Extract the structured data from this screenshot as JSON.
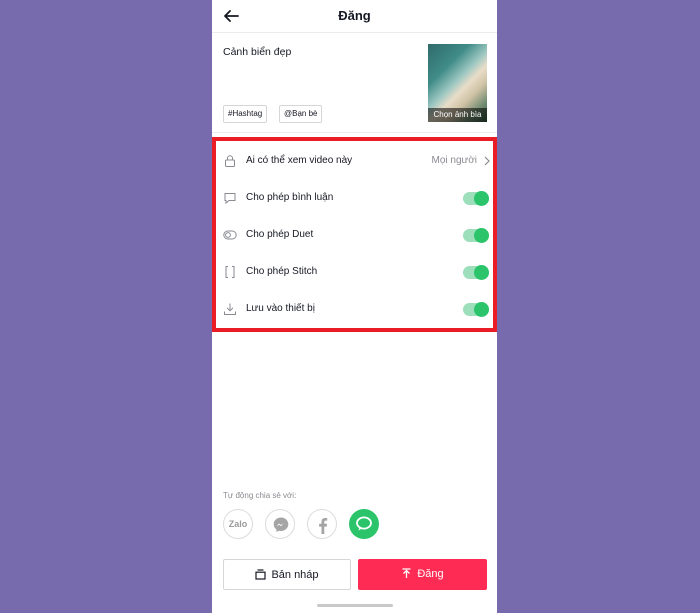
{
  "header": {
    "title": "Đăng"
  },
  "post": {
    "caption": "Cảnh biển đẹp",
    "cover_label": "Chọn ảnh bìa",
    "chips": [
      "#Hashtag",
      "@Bạn bè"
    ]
  },
  "settings": {
    "privacy": {
      "label": "Ai có thể xem video này",
      "value": "Mọi người"
    },
    "toggles": [
      {
        "label": "Cho phép bình luận",
        "on": true
      },
      {
        "label": "Cho phép Duet",
        "on": true
      },
      {
        "label": "Cho phép Stitch",
        "on": true
      },
      {
        "label": "Lưu vào thiết bị",
        "on": true
      }
    ]
  },
  "share": {
    "title": "Tự động chia sẻ với:",
    "zalo_label": "Zalo",
    "targets": [
      "zalo",
      "messenger",
      "facebook",
      "sms"
    ]
  },
  "actions": {
    "draft_label": "Bản nháp",
    "post_label": "Đăng"
  },
  "colors": {
    "background": "#776aad",
    "highlight_border": "#ea1d26",
    "toggle_on": "#2cc46a",
    "post_button": "#fe2c55",
    "sms_icon": "#2cc46a"
  }
}
